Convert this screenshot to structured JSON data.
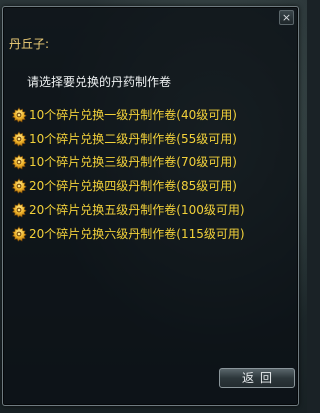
{
  "dialog": {
    "close_label": "×",
    "npc_name": "丹丘子:",
    "prompt": "请选择要兑换的丹药制作卷",
    "options": [
      {
        "label": "10个碎片兑换一级丹制作卷(40级可用)"
      },
      {
        "label": "10个碎片兑换二级丹制作卷(55级可用)"
      },
      {
        "label": "10个碎片兑换三级丹制作卷(70级可用)"
      },
      {
        "label": "20个碎片兑换四级丹制作卷(85级可用)"
      },
      {
        "label": "20个碎片兑换五级丹制作卷(100级可用)"
      },
      {
        "label": "20个碎片兑换六级丹制作卷(115级可用)"
      }
    ],
    "option_icon": "gear-icon",
    "return_label": "返回"
  },
  "colors": {
    "npc_name": "#f3d27a",
    "option_text": "#f2d13a",
    "prompt_text": "#eef1f2"
  }
}
